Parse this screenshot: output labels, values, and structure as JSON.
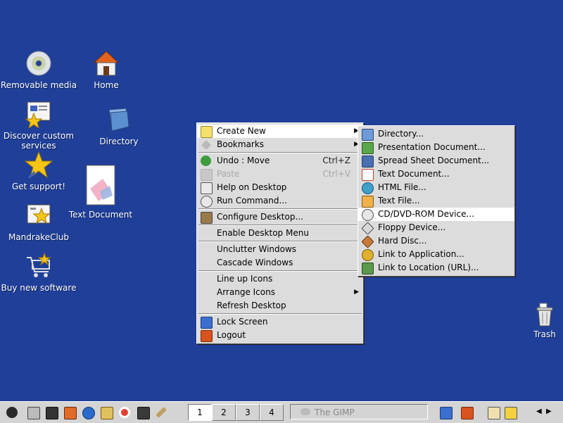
{
  "desktop": {
    "background_color": "#1f3f99",
    "icons": [
      {
        "label": "Removable media",
        "icon": "cd-icon"
      },
      {
        "label": "Home",
        "icon": "home-icon"
      },
      {
        "label": "Discover custom services",
        "icon": "services-icon"
      },
      {
        "label": "Directory",
        "icon": "folder-icon"
      },
      {
        "label": "Get support!",
        "icon": "star-icon"
      },
      {
        "label": "Text Document",
        "icon": "text-document-icon"
      },
      {
        "label": "MandrakeClub",
        "icon": "club-icon"
      },
      {
        "label": "Buy new software",
        "icon": "cart-icon"
      },
      {
        "label": "Trash",
        "icon": "trash-icon"
      }
    ]
  },
  "context_menu": {
    "items": [
      {
        "label": "Create New",
        "mnemonic": "N",
        "submenu": true,
        "highlighted": true
      },
      {
        "label": "Bookmarks",
        "submenu": true
      },
      {
        "label": "Undo : Move",
        "shortcut": "Ctrl+Z"
      },
      {
        "label": "Paste",
        "shortcut": "Ctrl+V",
        "disabled": true
      },
      {
        "label": "Help on Desktop"
      },
      {
        "label": "Run Command..."
      },
      {
        "label": "Configure Desktop..."
      },
      {
        "label": "Enable Desktop Menu"
      },
      {
        "label": "Unclutter Windows"
      },
      {
        "label": "Cascade Windows"
      },
      {
        "label": "Line up Icons"
      },
      {
        "label": "Arrange Icons",
        "submenu": true
      },
      {
        "label": "Refresh Desktop"
      },
      {
        "label": "Lock Screen"
      },
      {
        "label": "Logout"
      }
    ]
  },
  "create_new_submenu": {
    "items": [
      {
        "label": "Directory..."
      },
      {
        "label": "Presentation Document..."
      },
      {
        "label": "Spread Sheet Document..."
      },
      {
        "label": "Text Document..."
      },
      {
        "label": "HTML File..."
      },
      {
        "label": "Text File..."
      },
      {
        "label": "CD/DVD-ROM Device...",
        "highlighted": true
      },
      {
        "label": "Floppy Device..."
      },
      {
        "label": "Hard Disc..."
      },
      {
        "label": "Link to Application..."
      },
      {
        "label": "Link to Location (URL)..."
      }
    ]
  },
  "taskbar": {
    "virtual_desktops": [
      "1",
      "2",
      "3",
      "4"
    ],
    "active_desktop": "1",
    "task": "The GIMP"
  }
}
